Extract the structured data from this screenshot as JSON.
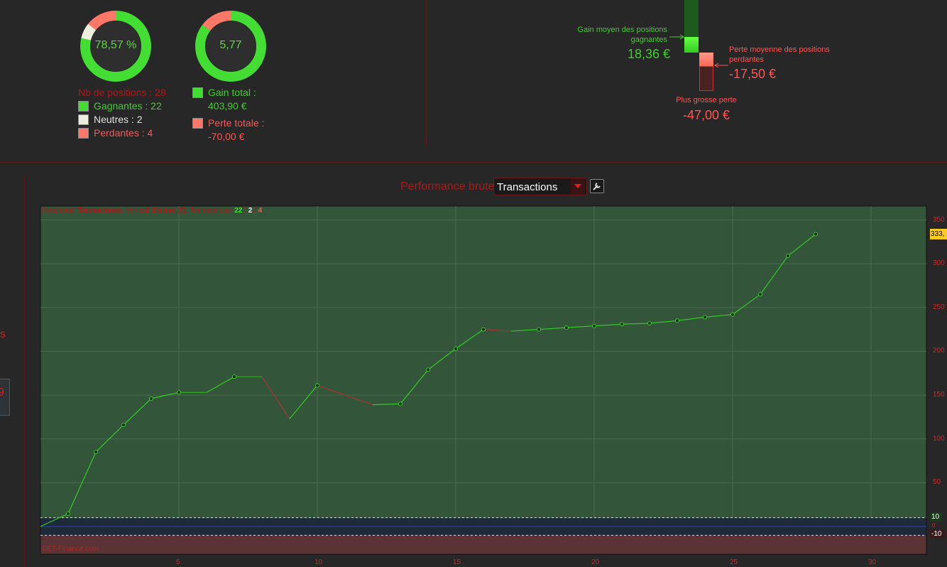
{
  "summary": {
    "win_rate": "78,57 %",
    "ratio": "5,77",
    "positions_label": "Nb de positions : 28",
    "winners_label": "Gagnantes : 22",
    "neutral_label": "Neutres : 2",
    "losers_label": "Perdantes : 4",
    "gain_total_label": "Gain total :",
    "gain_total_value": "403,90 €",
    "loss_total_label": "Perte totale :",
    "loss_total_value": "-70,00 €",
    "win_fraction": 0.7857,
    "neutral_fraction": 0.0714,
    "loss_fraction": 0.1429,
    "gain_share": 0.852,
    "loss_share": 0.148
  },
  "averages": {
    "avg_gain_label": "Gain moyen des positions gagnantes",
    "avg_gain_value": "18,36 €",
    "avg_loss_label": "Perte moyenne des positions perdantes",
    "avg_loss_value": "-17,50 €",
    "max_loss_label": "Plus grosse perte",
    "max_loss_value": "-47,00 €"
  },
  "sidebar": {
    "partial_letter": "s",
    "partial_number": "9"
  },
  "perf": {
    "title": "Performance brute",
    "select_value": "Transactions",
    "settings_icon": "wrench-icon"
  },
  "chart_info": {
    "prefix": "Horizontal: ",
    "h_value": "Transactions",
    "mid": ", Vertical: ",
    "v_value": "Devise (€)",
    "tx_label": ", Transactions: ",
    "tx_win": "22",
    "tx_sep1": " / ",
    "tx_neutral": "2",
    "tx_sep2": " / ",
    "tx_loss": "4",
    "watermark": "©ET-Finance.com",
    "last_value_tag": "333,",
    "band_upper_tag": "10",
    "band_mid_tag": "0",
    "band_lower_tag": "-10"
  },
  "colors": {
    "win": "#33cc22",
    "loss": "#aa3333",
    "plot_bg": "#33553a",
    "loss_bg": "#5a3434",
    "text_red": "#cc2a2a",
    "text_green": "#44cc33",
    "text_salmon": "#ff6666"
  },
  "chart_data": {
    "type": "line",
    "xlabel": "Transactions",
    "ylabel": "Devise (€)",
    "xlim": [
      0,
      32
    ],
    "ylim": [
      -10,
      350
    ],
    "x_ticks": [
      5,
      10,
      15,
      20,
      25,
      30
    ],
    "y_ticks": [
      50,
      100,
      150,
      200,
      250,
      300,
      350
    ],
    "band": [
      -10,
      10
    ],
    "x": [
      0,
      1,
      2,
      3,
      4,
      5,
      6,
      7,
      8,
      9,
      10,
      11,
      12,
      13,
      14,
      15,
      16,
      17,
      18,
      19,
      20,
      21,
      22,
      23,
      24,
      25,
      26,
      27,
      28
    ],
    "values": [
      0,
      14.6,
      85,
      116,
      146,
      153,
      153,
      171,
      171,
      123,
      161,
      150,
      139,
      140,
      179,
      203,
      225,
      223,
      225,
      227,
      229,
      231,
      232,
      235,
      239,
      242,
      265,
      309,
      333.7
    ],
    "outcome": [
      "start",
      "win",
      "win",
      "win",
      "win",
      "win",
      "neutral",
      "win",
      "neutral",
      "loss",
      "win",
      "loss",
      "loss",
      "win",
      "win",
      "win",
      "win",
      "loss",
      "win",
      "win",
      "win",
      "win",
      "win",
      "win",
      "win",
      "win",
      "win",
      "win",
      "win"
    ]
  }
}
